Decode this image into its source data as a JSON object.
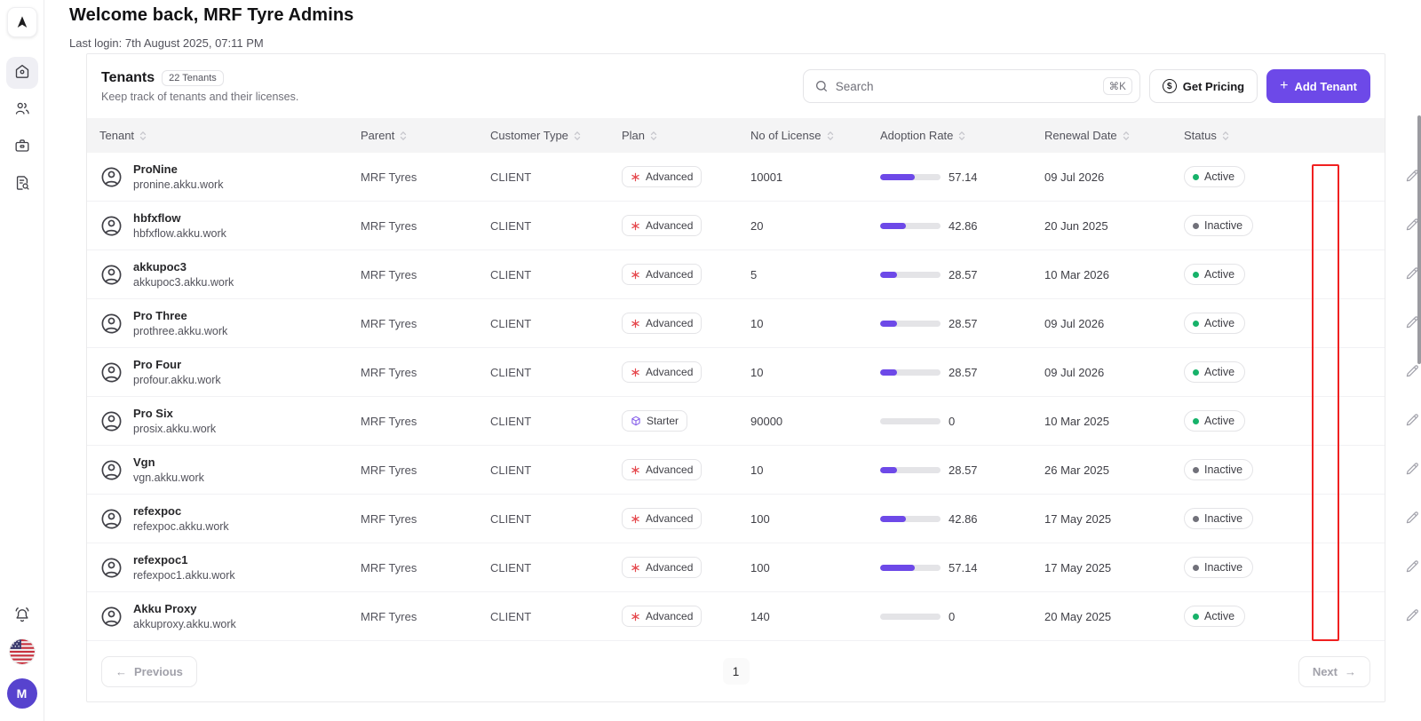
{
  "colors": {
    "accent": "#6D49E8",
    "avatar": "#5743CE",
    "green": "#17B26A",
    "inactive_dot": "#71717A",
    "annotation_red": "#F02020",
    "advanced_icon": "#E5484D",
    "starter_icon": "#7C52E8"
  },
  "sidebar": {
    "nav": [
      {
        "icon": "home-icon",
        "active": true
      },
      {
        "icon": "users-icon",
        "active": false
      },
      {
        "icon": "briefcase-icon",
        "active": false
      },
      {
        "icon": "document-search-icon",
        "active": false
      }
    ],
    "avatar_letter": "M"
  },
  "header": {
    "title": "Welcome back, MRF Tyre Admins",
    "last_login": "Last login: 7th August 2025, 07:11 PM"
  },
  "section": {
    "title": "Tenants",
    "count_badge": "22 Tenants",
    "subtitle": "Keep track of tenants and their licenses."
  },
  "toolbar": {
    "search_placeholder": "Search",
    "search_shortcut": "⌘K",
    "get_pricing_label": "Get Pricing",
    "add_tenant_label": "Add Tenant",
    "add_tenant_plus": "+"
  },
  "table": {
    "columns": [
      {
        "key": "tenant",
        "label": "Tenant"
      },
      {
        "key": "parent",
        "label": "Parent"
      },
      {
        "key": "customer_type",
        "label": "Customer Type"
      },
      {
        "key": "plan",
        "label": "Plan"
      },
      {
        "key": "licenses",
        "label": "No of License"
      },
      {
        "key": "adoption",
        "label": "Adoption Rate"
      },
      {
        "key": "renewal",
        "label": "Renewal Date"
      },
      {
        "key": "status",
        "label": "Status"
      }
    ],
    "rows": [
      {
        "name": "ProNine",
        "domain": "pronine.akku.work",
        "parent": "MRF Tyres",
        "customer_type": "CLIENT",
        "plan": "Advanced",
        "licenses": "10001",
        "adoption": 57.14,
        "adoption_label": "57.14",
        "renewal": "09 Jul 2026",
        "status": "Active"
      },
      {
        "name": "hbfxflow",
        "domain": "hbfxflow.akku.work",
        "parent": "MRF Tyres",
        "customer_type": "CLIENT",
        "plan": "Advanced",
        "licenses": "20",
        "adoption": 42.86,
        "adoption_label": "42.86",
        "renewal": "20 Jun 2025",
        "status": "Inactive"
      },
      {
        "name": "akkupoc3",
        "domain": "akkupoc3.akku.work",
        "parent": "MRF Tyres",
        "customer_type": "CLIENT",
        "plan": "Advanced",
        "licenses": "5",
        "adoption": 28.57,
        "adoption_label": "28.57",
        "renewal": "10 Mar 2026",
        "status": "Active"
      },
      {
        "name": "Pro Three",
        "domain": "prothree.akku.work",
        "parent": "MRF Tyres",
        "customer_type": "CLIENT",
        "plan": "Advanced",
        "licenses": "10",
        "adoption": 28.57,
        "adoption_label": "28.57",
        "renewal": "09 Jul 2026",
        "status": "Active"
      },
      {
        "name": "Pro Four",
        "domain": "profour.akku.work",
        "parent": "MRF Tyres",
        "customer_type": "CLIENT",
        "plan": "Advanced",
        "licenses": "10",
        "adoption": 28.57,
        "adoption_label": "28.57",
        "renewal": "09 Jul 2026",
        "status": "Active"
      },
      {
        "name": "Pro Six",
        "domain": "prosix.akku.work",
        "parent": "MRF Tyres",
        "customer_type": "CLIENT",
        "plan": "Starter",
        "licenses": "90000",
        "adoption": 0,
        "adoption_label": "0",
        "renewal": "10 Mar 2025",
        "status": "Active"
      },
      {
        "name": "Vgn",
        "domain": "vgn.akku.work",
        "parent": "MRF Tyres",
        "customer_type": "CLIENT",
        "plan": "Advanced",
        "licenses": "10",
        "adoption": 28.57,
        "adoption_label": "28.57",
        "renewal": "26 Mar 2025",
        "status": "Inactive"
      },
      {
        "name": "refexpoc",
        "domain": "refexpoc.akku.work",
        "parent": "MRF Tyres",
        "customer_type": "CLIENT",
        "plan": "Advanced",
        "licenses": "100",
        "adoption": 42.86,
        "adoption_label": "42.86",
        "renewal": "17 May 2025",
        "status": "Inactive"
      },
      {
        "name": "refexpoc1",
        "domain": "refexpoc1.akku.work",
        "parent": "MRF Tyres",
        "customer_type": "CLIENT",
        "plan": "Advanced",
        "licenses": "100",
        "adoption": 57.14,
        "adoption_label": "57.14",
        "renewal": "17 May 2025",
        "status": "Inactive"
      },
      {
        "name": "Akku Proxy",
        "domain": "akkuproxy.akku.work",
        "parent": "MRF Tyres",
        "customer_type": "CLIENT",
        "plan": "Advanced",
        "licenses": "140",
        "adoption": 0,
        "adoption_label": "0",
        "renewal": "20 May 2025",
        "status": "Active"
      }
    ]
  },
  "pagination": {
    "previous_label": "Previous",
    "previous_arrow": "←",
    "current_page": "1",
    "next_label": "Next",
    "next_arrow": "→"
  }
}
